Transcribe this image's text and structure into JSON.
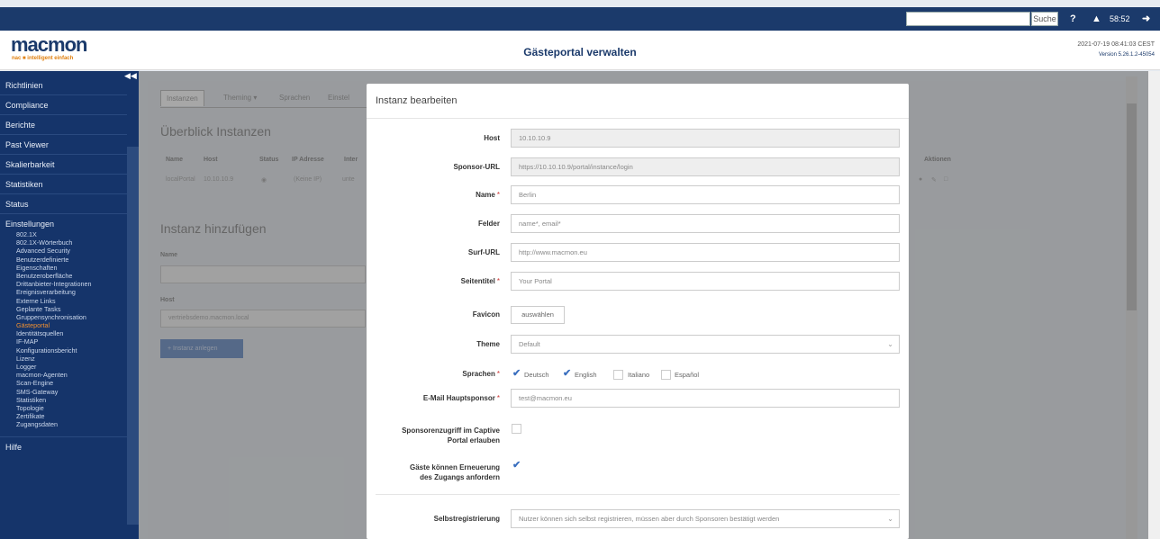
{
  "topbar": {
    "search_button": "Suche",
    "help_icon": "help-icon",
    "user_icon": "user-icon",
    "session_time": "58:52",
    "logout_icon": "logout-icon"
  },
  "header": {
    "logo": "macmon",
    "logo_tagline": "nac ■ intelligent einfach",
    "page_title": "Gästeportal verwalten",
    "datetime": "2021-07-19 08:41:03 CEST",
    "version": "Version 5.26.1.2-45054"
  },
  "sidebar": {
    "collapse_icon": "double-chevron-left-icon",
    "top_items": [
      {
        "label": "Richtlinien"
      },
      {
        "label": "Compliance"
      },
      {
        "label": "Berichte"
      },
      {
        "label": "Past Viewer"
      },
      {
        "label": "Skalierbarkeit"
      },
      {
        "label": "Statistiken"
      },
      {
        "label": "Status"
      }
    ],
    "settings_label": "Einstellungen",
    "settings_items": [
      {
        "label": "802.1X"
      },
      {
        "label": "802.1X-Wörterbuch"
      },
      {
        "label": "Advanced Security"
      },
      {
        "label": "Benutzerdefinierte"
      },
      {
        "label": "Eigenschaften"
      },
      {
        "label": "Benutzeroberfläche"
      },
      {
        "label": "Drittanbieter-Integrationen"
      },
      {
        "label": "Ereignisverarbeitung"
      },
      {
        "label": "Externe Links"
      },
      {
        "label": "Geplante Tasks"
      },
      {
        "label": "Gruppensynchronisation"
      },
      {
        "label": "Gästeportal"
      },
      {
        "label": "Identitätsquellen"
      },
      {
        "label": "IF-MAP"
      },
      {
        "label": "Konfigurationsbericht"
      },
      {
        "label": "Lizenz"
      },
      {
        "label": "Logger"
      },
      {
        "label": "macmon-Agenten"
      },
      {
        "label": "Scan-Engine"
      },
      {
        "label": "SMS-Gateway"
      },
      {
        "label": "Statistiken"
      },
      {
        "label": "Topologie"
      },
      {
        "label": "Zertifikate"
      },
      {
        "label": "Zugangsdaten"
      }
    ],
    "active_item": "Gästeportal",
    "help_label": "Hilfe"
  },
  "content": {
    "tabs": [
      {
        "label": "Instanzen"
      },
      {
        "label": "Theming ▾"
      },
      {
        "label": "Sprachen"
      },
      {
        "label": "Einstel"
      }
    ],
    "overview_title": "Überblick Instanzen",
    "table_headers": [
      "Name",
      "Host",
      "Status",
      "IP Adresse",
      "Inter"
    ],
    "table_row": [
      "localPortal",
      "10.10.10.9",
      "◉",
      "(Keine IP)",
      "unte"
    ],
    "actions_header": "Aktionen",
    "action_icons": [
      "view-icon",
      "edit-icon",
      "delete-icon"
    ],
    "add_title": "Instanz hinzufügen",
    "add_name_label": "Name",
    "add_host_label": "Host",
    "add_host_value": "vertriebsdemo.macmon.local",
    "add_button": "+ Instanz anlegen"
  },
  "modal": {
    "title": "Instanz bearbeiten",
    "fields": {
      "host": {
        "label": "Host",
        "value": "10.10.10.9"
      },
      "sponsor_url": {
        "label": "Sponsor-URL",
        "value": "https://10.10.10.9/portal/instance/login"
      },
      "name": {
        "label": "Name",
        "value": "Berlin"
      },
      "felder": {
        "label": "Felder",
        "value": "name*, email*"
      },
      "surf_url": {
        "label": "Surf-URL",
        "value": "http://www.macmon.eu"
      },
      "seitentitel": {
        "label": "Seitentitel",
        "value": "Your Portal"
      },
      "favicon": {
        "label": "Favicon",
        "button": "auswählen"
      },
      "theme": {
        "label": "Theme",
        "value": "Default"
      },
      "sprachen": {
        "label": "Sprachen",
        "options": [
          {
            "label": "Deutsch",
            "checked": true
          },
          {
            "label": "English",
            "checked": true
          },
          {
            "label": "Italiano",
            "checked": false
          },
          {
            "label": "Español",
            "checked": false
          }
        ]
      },
      "email": {
        "label": "E-Mail Hauptsponsor",
        "value": "test@macmon.eu"
      },
      "sponsor_access": {
        "label_line1": "Sponsorenzugriff im Captive",
        "label_line2": "Portal erlauben",
        "checked": false
      },
      "renewal": {
        "label_line1": "Gäste können Erneuerung",
        "label_line2": "des Zugangs anfordern",
        "checked": true
      },
      "self_registration": {
        "label": "Selbstregistrierung",
        "value": "Nutzer können sich selbst registrieren, müssen aber durch Sponsoren bestätigt werden"
      }
    },
    "required_mark": "*",
    "check_mark": "✔"
  },
  "colors": {
    "navy": "#1b3a6b",
    "sidebar": "#15346a",
    "accent_orange": "#f09030",
    "checkbox_blue": "#3a6fbf"
  }
}
